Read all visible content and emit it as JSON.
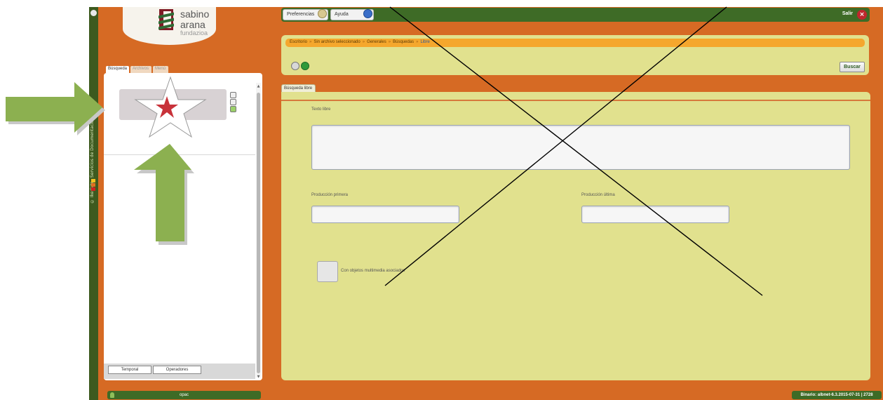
{
  "sidebar_strip": {
    "vertical_text": "© Ikerlatz - Servicios de Documentación S.A.",
    "status_dot_colors": [
      "#f4c020",
      "#e07020",
      "#d02020"
    ]
  },
  "logo": {
    "line1": "sabino",
    "line2": "arana",
    "line3": "fundazioa",
    "colors": {
      "mark": "#7f1b26",
      "stripes": "#2e6b35"
    }
  },
  "topbar": {
    "preferences_label": "Preferencias",
    "help_label": "Ayuda",
    "exit_label": "Salir",
    "exit_icon": "close-icon",
    "color": "#3e6b26"
  },
  "breadcrumb": {
    "items": [
      "Escritorio",
      "Sin archivo seleccionado",
      "Generales",
      "Búsquedas",
      "Libre"
    ],
    "separator": "»"
  },
  "toolbar": {
    "edit_icon": "pencil-icon",
    "confirm_icon": "check-icon",
    "search_button": "Buscar"
  },
  "main_tab": {
    "label": "Búsqueda libre"
  },
  "form": {
    "free_text_label": "Texto libre",
    "free_text_value": "",
    "production_first_label": "Producción primera",
    "production_first_value": "",
    "production_last_label": "Producción última",
    "production_last_value": "",
    "multimedia_label": "Con objetos multimedia asociados",
    "multimedia_checked": false
  },
  "left_panel": {
    "tabs": [
      "Búsqueda",
      "Archivos",
      "Menú"
    ],
    "bottom_tabs": [
      "Temporal",
      "Operadores"
    ],
    "icons": [
      "zoom-icon",
      "refresh-icon",
      "add-icon"
    ]
  },
  "footer": {
    "opac_label": "opac",
    "binary_label": "Binario: albnet-6.3.2015-07-31 | 2728"
  },
  "annotations": {
    "arrow_color": "#8cb050",
    "star_color": "#c8323a",
    "cross_color": "#000000"
  },
  "colors": {
    "background": "#d66a24",
    "panel": "#e1e18e",
    "accent_orange": "#f5a72d"
  }
}
